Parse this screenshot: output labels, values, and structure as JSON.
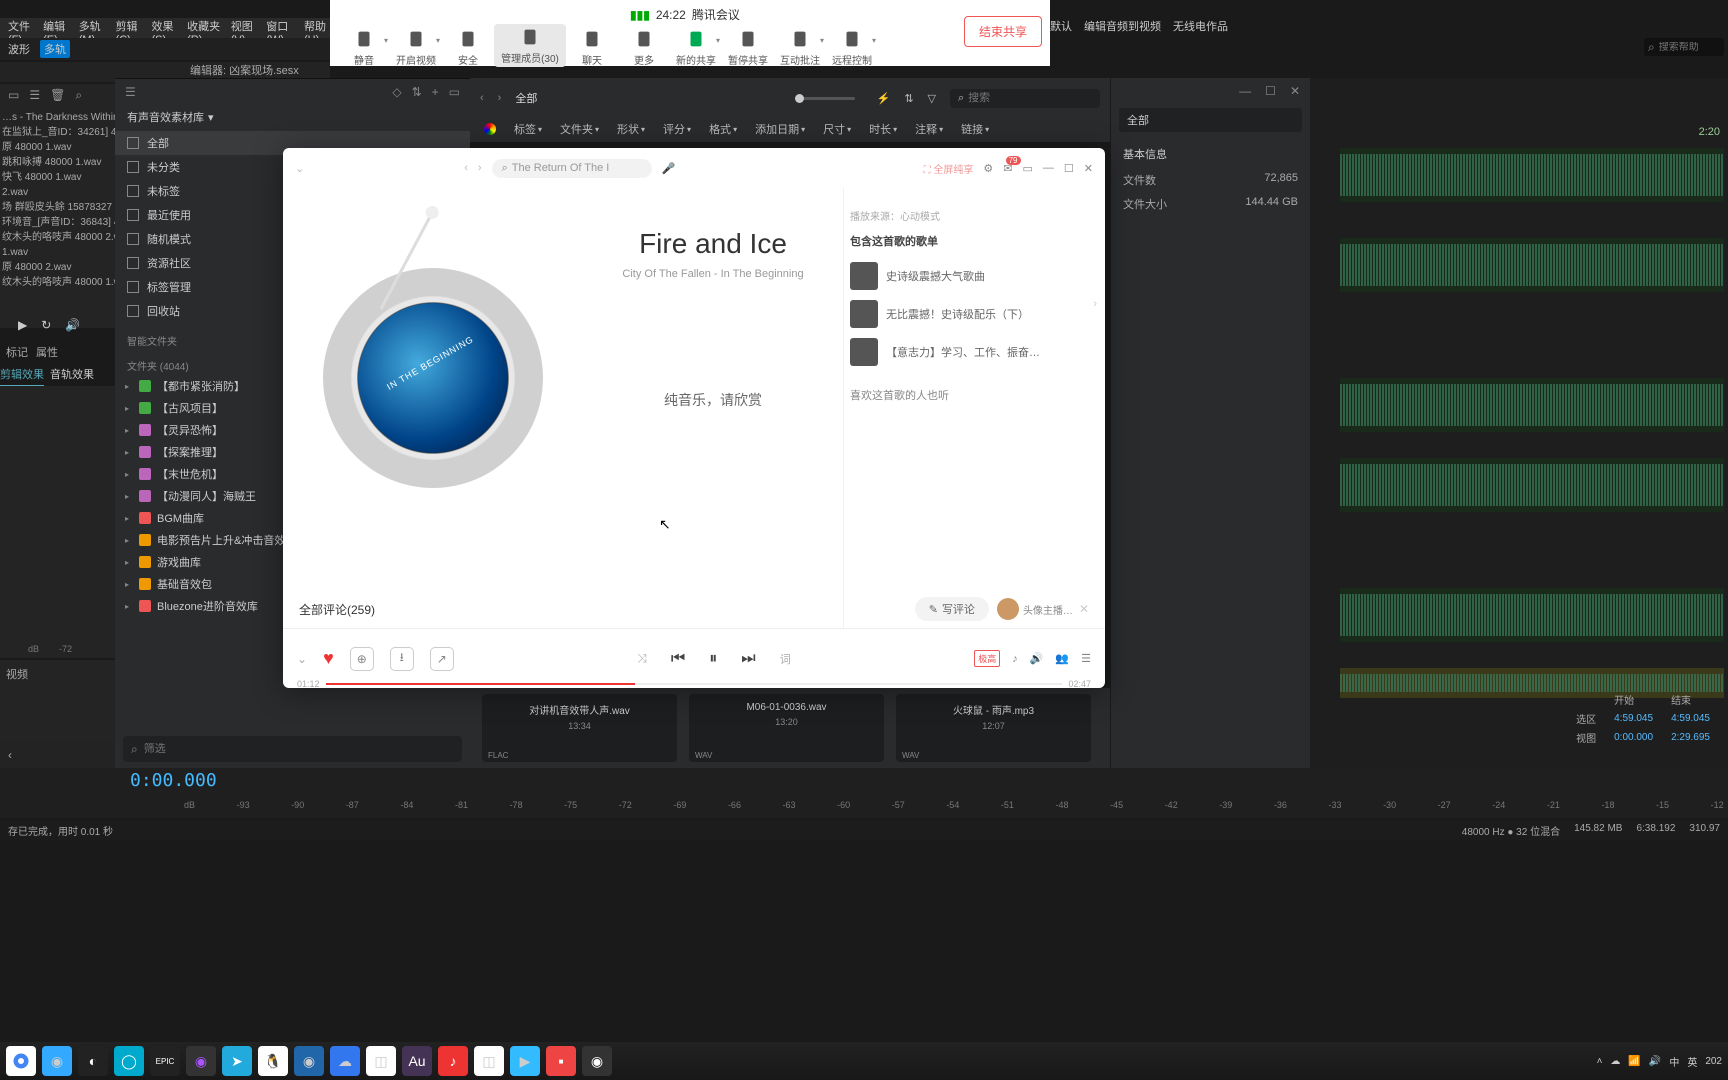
{
  "meeting": {
    "time": "24:22",
    "name": "腾讯会议",
    "items": [
      {
        "label": "静音",
        "drop": true
      },
      {
        "label": "开启视频",
        "drop": true
      },
      {
        "label": "安全"
      },
      {
        "label": "管理成员(30)",
        "sel": true,
        "wide": true
      },
      {
        "label": "聊天"
      },
      {
        "label": "更多"
      },
      {
        "label": "新的共享",
        "drop": true,
        "green": true
      },
      {
        "label": "暂停共享"
      },
      {
        "label": "互动批注",
        "drop": true
      },
      {
        "label": "远程控制",
        "drop": true
      }
    ],
    "end": "结束共享"
  },
  "audition": {
    "menu": [
      "文件(F)",
      "编辑(E)",
      "多轨(M)",
      "剪辑(C)",
      "效果(S)",
      "收藏夹(R)",
      "视图(V)",
      "窗口(W)",
      "帮助(H)"
    ],
    "right_menu": [
      "默认",
      "编辑音频到视频",
      "无线电作品"
    ],
    "help_search_placeholder": "搜索帮助",
    "toolbar_wave": "波形",
    "toolbar_multi": "多轨",
    "editor_header": "编辑器: 凶案现场.sesx",
    "files": [
      "…s - The Darkness Within 480",
      "在监狱上_音ID：34261] 48…",
      "原 48000 1.wav",
      "跳和咏搏 48000 1.wav",
      "快飞 48000 1.wav",
      "2.wav",
      "场 群殴皮头餘 15878327 480",
      "环境音_[声音ID：36843] 4…",
      "纹木头的咯吱声 48000 2.wa",
      "1.wav",
      "原 48000 2.wav",
      "纹木头的咯吱声 48000 1.wa"
    ],
    "tabs1": [
      "标记",
      "属性"
    ],
    "tabs2": [
      "剪辑效果",
      "音轨效果"
    ],
    "meter": [
      "dB",
      "-72"
    ],
    "video_label": "视频",
    "timecode": "2:20",
    "tc_big": "0:00.000",
    "ruler": [
      "dB",
      "-93",
      "-90",
      "-87",
      "-84",
      "-81",
      "-78",
      "-75",
      "-72",
      "-69",
      "-66",
      "-63",
      "-60",
      "-57",
      "-54",
      "-51",
      "-48",
      "-45",
      "-42",
      "-39",
      "-36",
      "-33",
      "-30",
      "-27",
      "-24",
      "-21",
      "-18",
      "-15",
      "-12"
    ],
    "status_left": "存已完成，用时 0.01 秒",
    "status_right": [
      "48000 Hz ● 32 位混合",
      "145.82 MB",
      "6:38.192",
      "310.97"
    ],
    "sel_table": {
      "h1": "开始",
      "h2": "结束",
      "r1": "选区",
      "v1": "4:59.045",
      "v2": "4:59.045",
      "r2": "视图",
      "v3": "0:00.000",
      "v4": "2:29.695"
    }
  },
  "eagle": {
    "lib_name": "有声音效素材库",
    "cats": [
      {
        "label": "全部",
        "sel": true
      },
      {
        "label": "未分类"
      },
      {
        "label": "未标签"
      },
      {
        "label": "最近使用"
      },
      {
        "label": "随机模式"
      },
      {
        "label": "资源社区"
      },
      {
        "label": "标签管理"
      },
      {
        "label": "回收站"
      }
    ],
    "smart": "智能文件夹",
    "folders_hdr": "文件夹 (4044)",
    "folders": [
      {
        "label": "【都市紧张消防】",
        "c": "#4a4"
      },
      {
        "label": "【古风项目】",
        "c": "#4a4"
      },
      {
        "label": "【灵异恐怖】",
        "c": "#b6b"
      },
      {
        "label": "【探案推理】",
        "c": "#b6b"
      },
      {
        "label": "【末世危机】",
        "c": "#b6b"
      },
      {
        "label": "【动漫同人】海贼王",
        "c": "#b6b"
      },
      {
        "label": "BGM曲库",
        "c": "#e55"
      },
      {
        "label": "电影预告片上升&冲击音效库",
        "c": "#e90"
      },
      {
        "label": "游戏曲库",
        "c": "#e90"
      },
      {
        "label": "基础音效包",
        "c": "#e90"
      },
      {
        "label": "Bluezone进阶音效库",
        "c": "#e55"
      }
    ],
    "filter_placeholder": "筛选",
    "main_title": "全部",
    "search_placeholder": "搜索",
    "filters": [
      "标签",
      "文件夹",
      "形状",
      "评分",
      "格式",
      "添加日期",
      "尺寸",
      "时长",
      "注释",
      "链接"
    ],
    "files": [
      {
        "name": "对讲机音效带人声.wav",
        "dur": "13:34",
        "tag": "FLAC"
      },
      {
        "name": "M06-01-0036.wav",
        "dur": "13:20",
        "tag": "WAV"
      },
      {
        "name": "火球鼠 - 雨声.mp3",
        "dur": "12:07",
        "tag": "WAV"
      }
    ],
    "info": {
      "title": "全部",
      "section": "基本信息",
      "rows": [
        {
          "k": "文件数",
          "v": "72,865"
        },
        {
          "k": "文件大小",
          "v": "144.44 GB"
        }
      ]
    }
  },
  "music": {
    "search_text": "The Return Of The I",
    "fullscreen": "全屏纯享",
    "badge_count": "79",
    "title": "Fire and Ice",
    "subtitle": "City Of The Fallen - In The Beginning",
    "vinyl_text": "IN THE BEGINNING",
    "lyric": "纯音乐，请欣赏",
    "source": "播放来源：心动模式",
    "playlist_hdr": "包含这首歌的歌单",
    "playlists": [
      "史诗级震撼大气歌曲",
      "无比震撼！史诗级配乐（下）",
      "【意志力】学习、工作、振奋…"
    ],
    "also_like": "喜欢这首歌的人也听",
    "comments_label": "全部评论(259)",
    "write_label": "写评论",
    "avatar_label": "头像主播…",
    "quality": "极高",
    "time_cur": "01:12",
    "time_total": "02:47",
    "lyrics_btn": "词"
  },
  "taskbar": {
    "tray": [
      "中",
      "英",
      "202"
    ]
  }
}
